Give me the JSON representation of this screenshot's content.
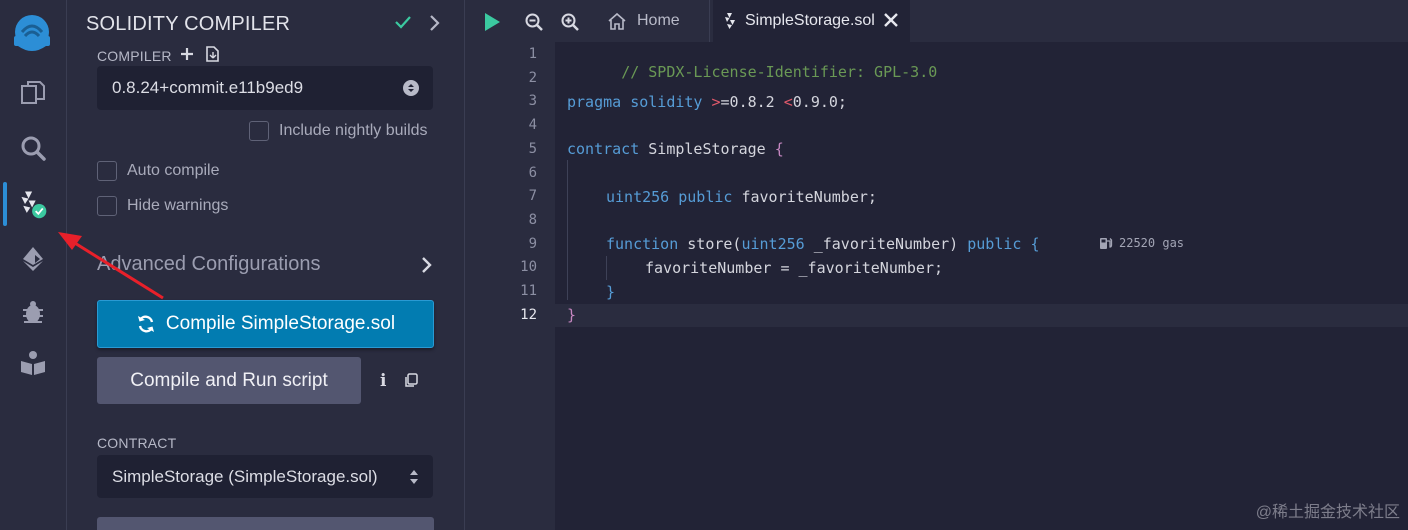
{
  "panel": {
    "title": "SOLIDITY COMPILER",
    "compiler_label": "COMPILER",
    "compiler_version": "0.8.24+commit.e11b9ed9",
    "include_nightly_label": "Include nightly builds",
    "auto_compile_label": "Auto compile",
    "hide_warnings_label": "Hide warnings",
    "advanced_label": "Advanced Configurations",
    "compile_button": "Compile SimpleStorage.sol",
    "run_button": "Compile and Run script",
    "info_glyph": "i",
    "contract_label": "CONTRACT",
    "contract_value": "SimpleStorage (SimpleStorage.sol)"
  },
  "tabs": {
    "home": "Home",
    "file": "SimpleStorage.sol"
  },
  "editor": {
    "line_numbers": [
      "1",
      "2",
      "3",
      "4",
      "5",
      "6",
      "7",
      "8",
      "9",
      "10",
      "11",
      "12"
    ],
    "current_line": "12",
    "gas_text": "22520 gas",
    "code": {
      "l1": "// SPDX-License-Identifier: GPL-3.0",
      "l3_kw": "pragma solidity ",
      "l3_op1": ">",
      "l3_v1": "=0.8.2 ",
      "l3_op2": "<",
      "l3_v2": "0.9.0;",
      "l5_kw": "contract",
      "l5_name": " SimpleStorage ",
      "l5_brace": "{",
      "l7_type": "uint256",
      "l7_mod": " public",
      "l7_name": " favoriteNumber;",
      "l9_kw": "function",
      "l9_name": " store(",
      "l9_type": "uint256",
      "l9_param": " _favoriteNumber) ",
      "l9_mod": "public",
      "l9_brace": " {",
      "l10": "favoriteNumber = _favoriteNumber;",
      "l11": "}",
      "l12": "}"
    }
  },
  "watermark": "@稀土掘金技术社区",
  "colors": {
    "accent": "#027cb1",
    "success": "#3bc9a0",
    "annotation_arrow": "#e8202a"
  }
}
